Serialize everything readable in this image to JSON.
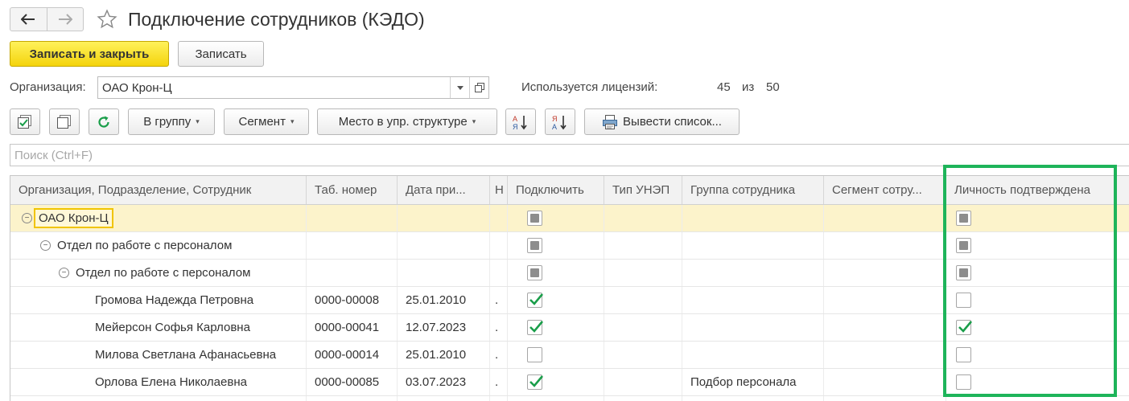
{
  "window": {
    "title": "Подключение сотрудников (КЭДО)"
  },
  "commands": {
    "save_close": "Записать и закрыть",
    "save": "Записать"
  },
  "org": {
    "label": "Организация:",
    "value": "ОАО Крон-Ц",
    "licenses_label": "Используется лицензий:",
    "licenses_used": "45",
    "licenses_sep": "из",
    "licenses_total": "50"
  },
  "toolbar": {
    "to_group": "В группу",
    "segment": "Сегмент",
    "place": "Место в упр. структуре",
    "print_list": "Вывести список..."
  },
  "search": {
    "placeholder": "Поиск (Ctrl+F)"
  },
  "grid": {
    "columns": {
      "name": "Организация, Подразделение, Сотрудник",
      "tab": "Таб. номер",
      "date": "Дата при...",
      "n": "Н",
      "connect": "Подключить",
      "type": "Тип УНЭП",
      "group": "Группа сотрудника",
      "segment": "Сегмент сотру...",
      "license": "Личность подтверждена"
    },
    "rows": [
      {
        "name": "ОАО Крон-Ц",
        "tab": "",
        "date": "",
        "n": "",
        "connect": "indeterminate",
        "type": "",
        "group": "",
        "segment": "",
        "license": "indeterminate"
      },
      {
        "name": "Отдел по работе с персоналом",
        "tab": "",
        "date": "",
        "n": "",
        "connect": "indeterminate",
        "type": "",
        "group": "",
        "segment": "",
        "license": "indeterminate"
      },
      {
        "name": "Отдел по работе с персоналом",
        "tab": "",
        "date": "",
        "n": "",
        "connect": "indeterminate",
        "type": "",
        "group": "",
        "segment": "",
        "license": "indeterminate"
      },
      {
        "name": "Громова Надежда Петровна",
        "tab": "0000-00008",
        "date": "25.01.2010",
        "n": ".",
        "connect": "checked",
        "type": "",
        "group": "",
        "segment": "",
        "license": "unchecked"
      },
      {
        "name": "Мейерсон Софья Карловна",
        "tab": "0000-00041",
        "date": "12.07.2023",
        "n": ".",
        "connect": "checked",
        "type": "",
        "group": "",
        "segment": "",
        "license": "checked"
      },
      {
        "name": "Милова Светлана Афанасьевна",
        "tab": "0000-00014",
        "date": "25.01.2010",
        "n": ".",
        "connect": "unchecked",
        "type": "",
        "group": "",
        "segment": "",
        "license": "unchecked"
      },
      {
        "name": "Орлова Елена Николаевна",
        "tab": "0000-00085",
        "date": "03.07.2023",
        "n": ".",
        "connect": "checked",
        "type": "",
        "group": "Подбор персонала",
        "segment": "",
        "license": "unchecked"
      }
    ]
  },
  "colors": {
    "primary_button": "#f4d40c",
    "check_mark": "#1a9e4a",
    "highlight_frame": "#1eb45a",
    "selected_row": "#fcf3cb"
  }
}
